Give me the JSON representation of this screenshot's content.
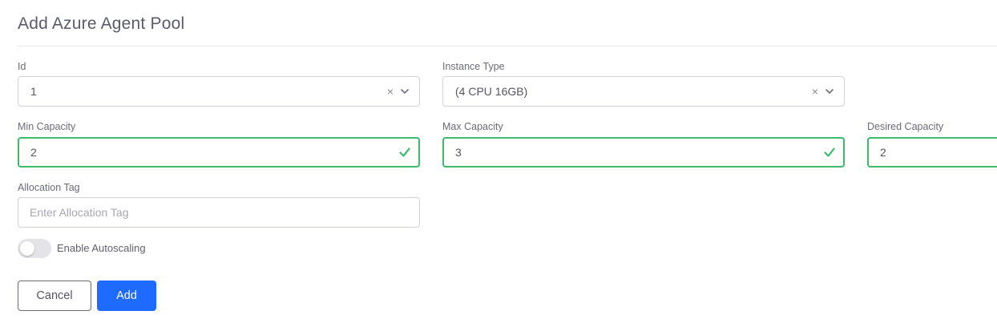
{
  "page": {
    "title": "Add Azure Agent Pool"
  },
  "form": {
    "id": {
      "label": "Id",
      "value": "1"
    },
    "instance_type": {
      "label": "Instance Type",
      "value": "(4 CPU 16GB)"
    },
    "min_capacity": {
      "label": "Min Capacity",
      "value": "2"
    },
    "max_capacity": {
      "label": "Max Capacity",
      "value": "3"
    },
    "desired_capacity": {
      "label": "Desired Capacity",
      "value": "2"
    },
    "allocation_tag": {
      "label": "Allocation Tag",
      "value": "",
      "placeholder": "Enter Allocation Tag"
    },
    "autoscaling": {
      "label": "Enable Autoscaling",
      "enabled": false
    }
  },
  "actions": {
    "cancel_label": "Cancel",
    "add_label": "Add"
  },
  "icons": {
    "clear": "×"
  },
  "colors": {
    "accent": "#1f6bff",
    "valid": "#3cb96a",
    "border": "#d2d2d8"
  }
}
